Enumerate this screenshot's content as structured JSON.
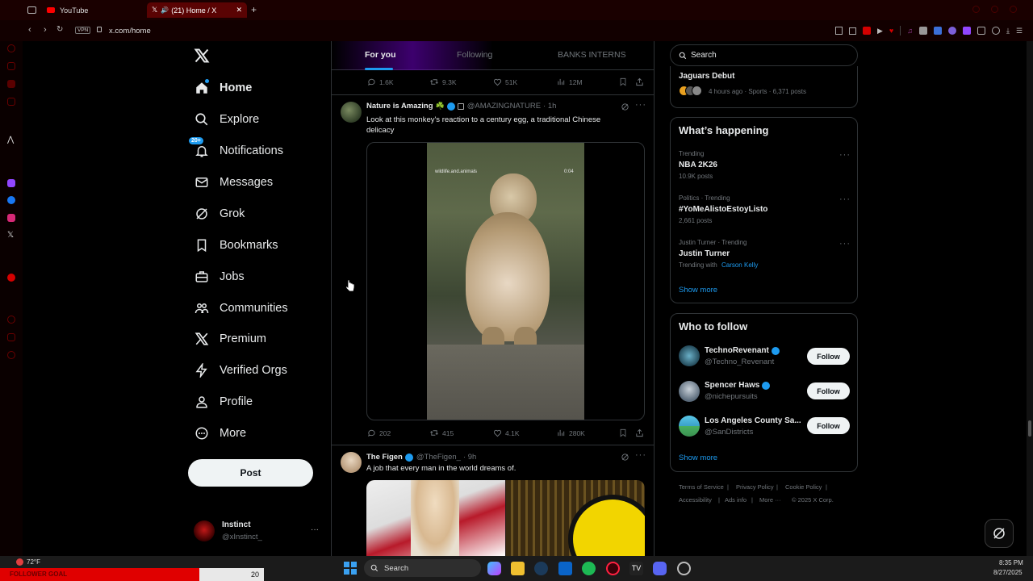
{
  "browser": {
    "tabs": [
      {
        "label": "YouTube"
      },
      {
        "label": "(21) Home / X"
      }
    ],
    "new_tab": "+",
    "vpn": "VPN",
    "url": "x.com/home"
  },
  "nav": {
    "items": [
      {
        "label": "Home",
        "icon": "home-icon"
      },
      {
        "label": "Explore",
        "icon": "search-icon"
      },
      {
        "label": "Notifications",
        "icon": "bell-icon",
        "badge": "20+"
      },
      {
        "label": "Messages",
        "icon": "mail-icon"
      },
      {
        "label": "Grok",
        "icon": "grok-icon"
      },
      {
        "label": "Bookmarks",
        "icon": "bookmark-icon"
      },
      {
        "label": "Jobs",
        "icon": "briefcase-icon"
      },
      {
        "label": "Communities",
        "icon": "people-icon"
      },
      {
        "label": "Premium",
        "icon": "x-icon"
      },
      {
        "label": "Verified Orgs",
        "icon": "lightning-icon"
      },
      {
        "label": "Profile",
        "icon": "person-icon"
      },
      {
        "label": "More",
        "icon": "more-circle-icon"
      }
    ],
    "post_button": "Post",
    "account": {
      "name": "Instinct",
      "handle": "@xInstinct_",
      "more": "···"
    }
  },
  "feed": {
    "tabs": [
      "For you",
      "Following",
      "BANKS INTERNS"
    ],
    "top_actions": {
      "replies": "1.6K",
      "reposts": "9.3K",
      "likes": "51K",
      "views": "12M"
    },
    "posts": [
      {
        "name": "Nature is Amazing",
        "emoji": "☘️",
        "handle": "@AMAZINGNATURE",
        "time": "· 1h",
        "text": "Look at this monkey's reaction to a century egg, a traditional Chinese delicacy",
        "video_watermark": "wildlife.and.animals",
        "video_time": "0:04",
        "replies": "202",
        "reposts": "415",
        "likes": "4.1K",
        "views": "280K"
      },
      {
        "name": "The Figen",
        "handle": "@TheFigen_",
        "time": "· 9h",
        "text": "A job that every man in the world dreams of."
      }
    ]
  },
  "right": {
    "search_placeholder": "Search",
    "top_trend": {
      "name": "Jaguars Debut",
      "meta": "4 hours ago · Sports · 6,371 posts"
    },
    "happening": {
      "title": "What’s happening",
      "trends": [
        {
          "meta": "Trending",
          "name": "NBA 2K26",
          "posts": "10.9K posts"
        },
        {
          "meta": "Politics · Trending",
          "name": "#YoMeAlistoEstoyListo",
          "posts": "2,661 posts"
        },
        {
          "meta": "Justin Turner · Trending",
          "name": "Justin Turner",
          "posts_prefix": "Trending with",
          "posts_link": "Carson Kelly"
        }
      ],
      "show_more": "Show more"
    },
    "who_to_follow": {
      "title": "Who to follow",
      "accounts": [
        {
          "name": "TechnoRevenant",
          "handle": "@Techno_Revenant",
          "button": "Follow"
        },
        {
          "name": "Spencer Haws",
          "handle": "@nichepursuits",
          "button": "Follow"
        },
        {
          "name": "Los Angeles County Sa...",
          "handle": "@SanDistricts",
          "button": "Follow"
        }
      ],
      "show_more": "Show more"
    },
    "footer": {
      "row1": [
        "Terms of Service",
        "|",
        "Privacy Policy",
        "|",
        "Cookie Policy",
        "|"
      ],
      "row2": [
        "Accessibility",
        "|",
        "Ads info",
        "|",
        "More ···",
        "© 2025 X Corp."
      ]
    }
  },
  "taskbar": {
    "weather": "72°F",
    "widget_label": "FOLLOWER GOAL",
    "widget_count": "20",
    "search_placeholder": "Search",
    "time": "8:35 PM",
    "date": "8/27/2025"
  },
  "colors": {
    "accent": "#1d9bf0",
    "browser_red": "#5a0303",
    "card_border": "#2f3336",
    "muted": "#71767b"
  }
}
